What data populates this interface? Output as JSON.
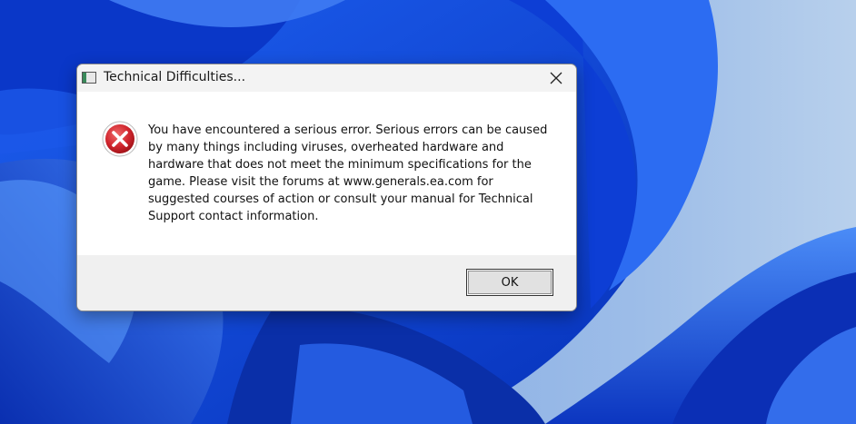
{
  "desktop": {
    "wallpaper": "windows-11-bloom",
    "colors": {
      "base": "#0a3fd1",
      "light": "#8fb3e6",
      "dark": "#04208f"
    }
  },
  "dialog": {
    "title": "Technical Difficulties...",
    "title_icon": "app-window-icon",
    "close_icon": "close-icon",
    "status_icon": "error-icon",
    "message": "You have encountered a serious error.  Serious errors can be caused by many things including viruses, overheated hardware and hardware that does not meet the minimum specifications for the game. Please visit the forums at www.generals.ea.com for suggested courses of action or consult your manual for Technical Support contact information.",
    "ok_label": "OK",
    "colors": {
      "error_red": "#d0252d",
      "content_bg": "#ffffff",
      "footer_bg": "#f0f0f0"
    }
  }
}
